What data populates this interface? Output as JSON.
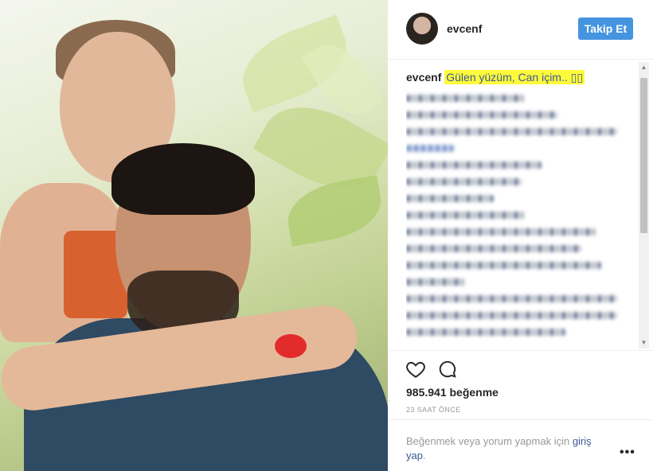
{
  "post": {
    "username": "evcenf",
    "follow_label": "Takip Et",
    "caption_user": "evcenf",
    "caption_text": "Gülen yüzüm, Can içim.. ▯▯",
    "likes": "985.941 beğenme",
    "timestamp": "23 SAAT ÖNCE",
    "login_prompt": "Beğenmek veya yorum yapmak için",
    "login_link": "giriş yap",
    "login_suffix": "."
  },
  "icons": {
    "like": "heart-icon",
    "comment": "comment-icon",
    "more": "ellipsis-icon"
  },
  "colors": {
    "follow_button": "#4494e0",
    "caption_highlight": "#fdfa3a",
    "link": "#3d5896"
  }
}
